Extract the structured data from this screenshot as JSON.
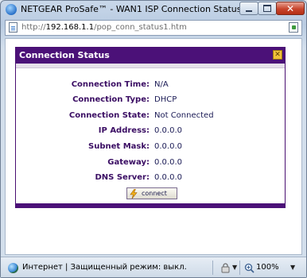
{
  "window": {
    "title": "NETGEAR ProSafe™ - WAN1 ISP Connection Status - Windows I..."
  },
  "address_bar": {
    "url_prefix": "http://",
    "url_host": "192.168.1.1",
    "url_path": "/pop_conn_status1.htm"
  },
  "panel": {
    "title": "Connection Status",
    "rows": [
      {
        "label": "Connection Time:",
        "value": "N/A"
      },
      {
        "label": "Connection Type:",
        "value": "DHCP"
      },
      {
        "label": "Connection State:",
        "value": "Not Connected"
      },
      {
        "label": "IP Address:",
        "value": "0.0.0.0"
      },
      {
        "label": "Subnet Mask:",
        "value": "0.0.0.0"
      },
      {
        "label": "Gateway:",
        "value": "0.0.0.0"
      },
      {
        "label": "DNS Server:",
        "value": "0.0.0.0"
      }
    ],
    "connect_label": "connect"
  },
  "status_bar": {
    "zone_text": "Интернет | Защищенный режим: выкл.",
    "zoom_label": "100%"
  },
  "colors": {
    "accent_purple": "#4b1178",
    "label_purple": "#3a0d63"
  },
  "icons": {
    "window": "ie-icon",
    "page": "page-icon",
    "zone": "globe-icon",
    "security": "security-icon",
    "zoom": "zoom-icon",
    "connect": "bolt-icon"
  }
}
